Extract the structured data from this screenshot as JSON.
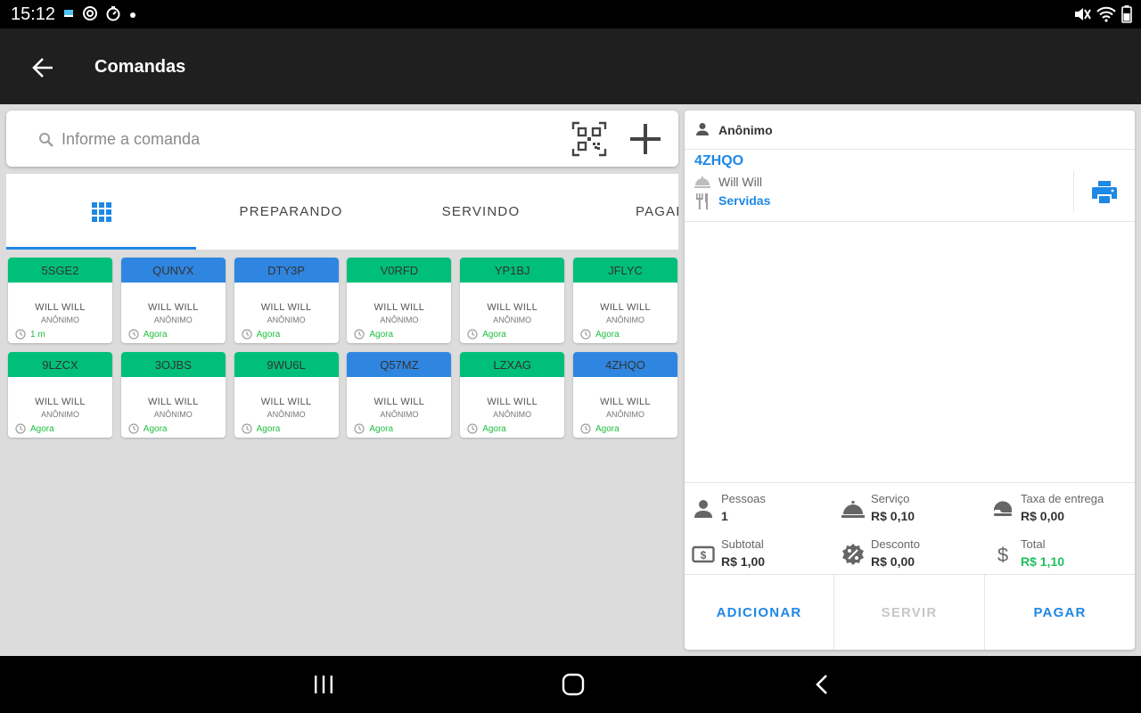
{
  "status_bar": {
    "time": "15:12",
    "left_icons": [
      "notification-app-icon",
      "sync-icon",
      "timer-icon",
      "dot-icon"
    ],
    "right_icons": [
      "mute-icon",
      "wifi-icon",
      "battery-icon"
    ]
  },
  "app_bar": {
    "title": "Comandas",
    "back_icon": "arrow-left-icon"
  },
  "search": {
    "placeholder": "Informe a comanda",
    "value": ""
  },
  "tabs": [
    {
      "label": "",
      "icon": "grid-icon",
      "active": true
    },
    {
      "label": "PREPARANDO",
      "active": false
    },
    {
      "label": "SERVINDO",
      "active": false
    },
    {
      "label": "PAGAR",
      "active": false
    }
  ],
  "cards": [
    {
      "code": "5SGE2",
      "name": "WILL WILL",
      "sub": "ANÔNIMO",
      "time": "1 m",
      "color": "green"
    },
    {
      "code": "QUNVX",
      "name": "WILL WILL",
      "sub": "ANÔNIMO",
      "time": "Agora",
      "color": "blue"
    },
    {
      "code": "DTY3P",
      "name": "WILL WILL",
      "sub": "ANÔNIMO",
      "time": "Agora",
      "color": "blue"
    },
    {
      "code": "V0RFD",
      "name": "WILL WILL",
      "sub": "ANÔNIMO",
      "time": "Agora",
      "color": "green"
    },
    {
      "code": "YP1BJ",
      "name": "WILL WILL",
      "sub": "ANÔNIMO",
      "time": "Agora",
      "color": "green"
    },
    {
      "code": "JFLYC",
      "name": "WILL WILL",
      "sub": "ANÔNIMO",
      "time": "Agora",
      "color": "green"
    },
    {
      "code": "9LZCX",
      "name": "WILL WILL",
      "sub": "ANÔNIMO",
      "time": "Agora",
      "color": "green"
    },
    {
      "code": "3OJBS",
      "name": "WILL WILL",
      "sub": "ANÔNIMO",
      "time": "Agora",
      "color": "green"
    },
    {
      "code": "9WU6L",
      "name": "WILL WILL",
      "sub": "ANÔNIMO",
      "time": "Agora",
      "color": "green"
    },
    {
      "code": "Q57MZ",
      "name": "WILL WILL",
      "sub": "ANÔNIMO",
      "time": "Agora",
      "color": "blue"
    },
    {
      "code": "LZXAG",
      "name": "WILL WILL",
      "sub": "ANÔNIMO",
      "time": "Agora",
      "color": "green"
    },
    {
      "code": "4ZHQO",
      "name": "WILL WILL",
      "sub": "ANÔNIMO",
      "time": "Agora",
      "color": "blue"
    }
  ],
  "panel": {
    "header": "Anônimo",
    "order_code": "4ZHQO",
    "customer": "Will Will",
    "status": "Servidas",
    "summary": {
      "pessoas": {
        "label": "Pessoas",
        "value": "1"
      },
      "servico": {
        "label": "Serviço",
        "value": "R$ 0,10"
      },
      "taxa": {
        "label": "Taxa de entrega",
        "value": "R$ 0,00"
      },
      "subtotal": {
        "label": "Subtotal",
        "value": "R$ 1,00"
      },
      "desconto": {
        "label": "Desconto",
        "value": "R$ 0,00"
      },
      "total": {
        "label": "Total",
        "value": "R$ 1,10"
      }
    },
    "actions": {
      "adicionar": "ADICIONAR",
      "servir": "SERVIR",
      "pagar": "PAGAR"
    }
  },
  "colors": {
    "accent": "#1e88e5",
    "card_green": "#00bf7a",
    "card_blue": "#2f86e0",
    "time_green": "#1fbf3f",
    "total_green": "#1fbf5f"
  }
}
